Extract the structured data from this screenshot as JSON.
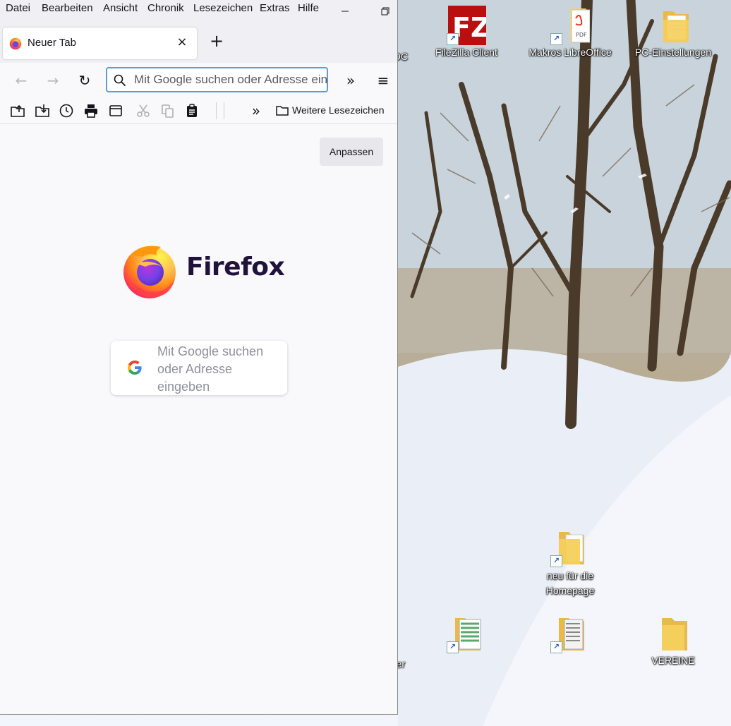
{
  "menubar": {
    "items": [
      "Datei",
      "Bearbeiten",
      "Ansicht",
      "Chronik",
      "Lesezeichen",
      "Extras",
      "Hilfe"
    ]
  },
  "window_controls": {
    "minimize": "—",
    "restore": "🗗"
  },
  "tab": {
    "title": "Neuer Tab",
    "close": "×"
  },
  "newtab": "+",
  "navbar": {
    "back": "←",
    "forward": "→",
    "reload": "↻",
    "url_placeholder": "Mit Google suchen oder Adresse eingeben",
    "overflow": "»",
    "menu": "≡"
  },
  "bookmarks": {
    "overflow": "»",
    "more_label": "Weitere Lesezeichen"
  },
  "newtab_page": {
    "customize_label": "Anpassen",
    "brand": "Firefox",
    "search_placeholder": "Mit Google suchen oder Adresse eingeben"
  },
  "desktop": {
    "icons": [
      {
        "label": "FileZilla Client"
      },
      {
        "label": "Makros LibreOffice"
      },
      {
        "label": "PC-Einstellungen"
      },
      {
        "label": "neu für die Homepage"
      },
      {
        "label": "VEREINE"
      }
    ],
    "partial_labels": [
      "DC",
      "er"
    ]
  },
  "colors": {
    "accent": "#5e9ad7",
    "toolbar_bg": "#f0f0f4",
    "content_bg": "#f9f9fb",
    "folder": "#f5cf5b"
  }
}
